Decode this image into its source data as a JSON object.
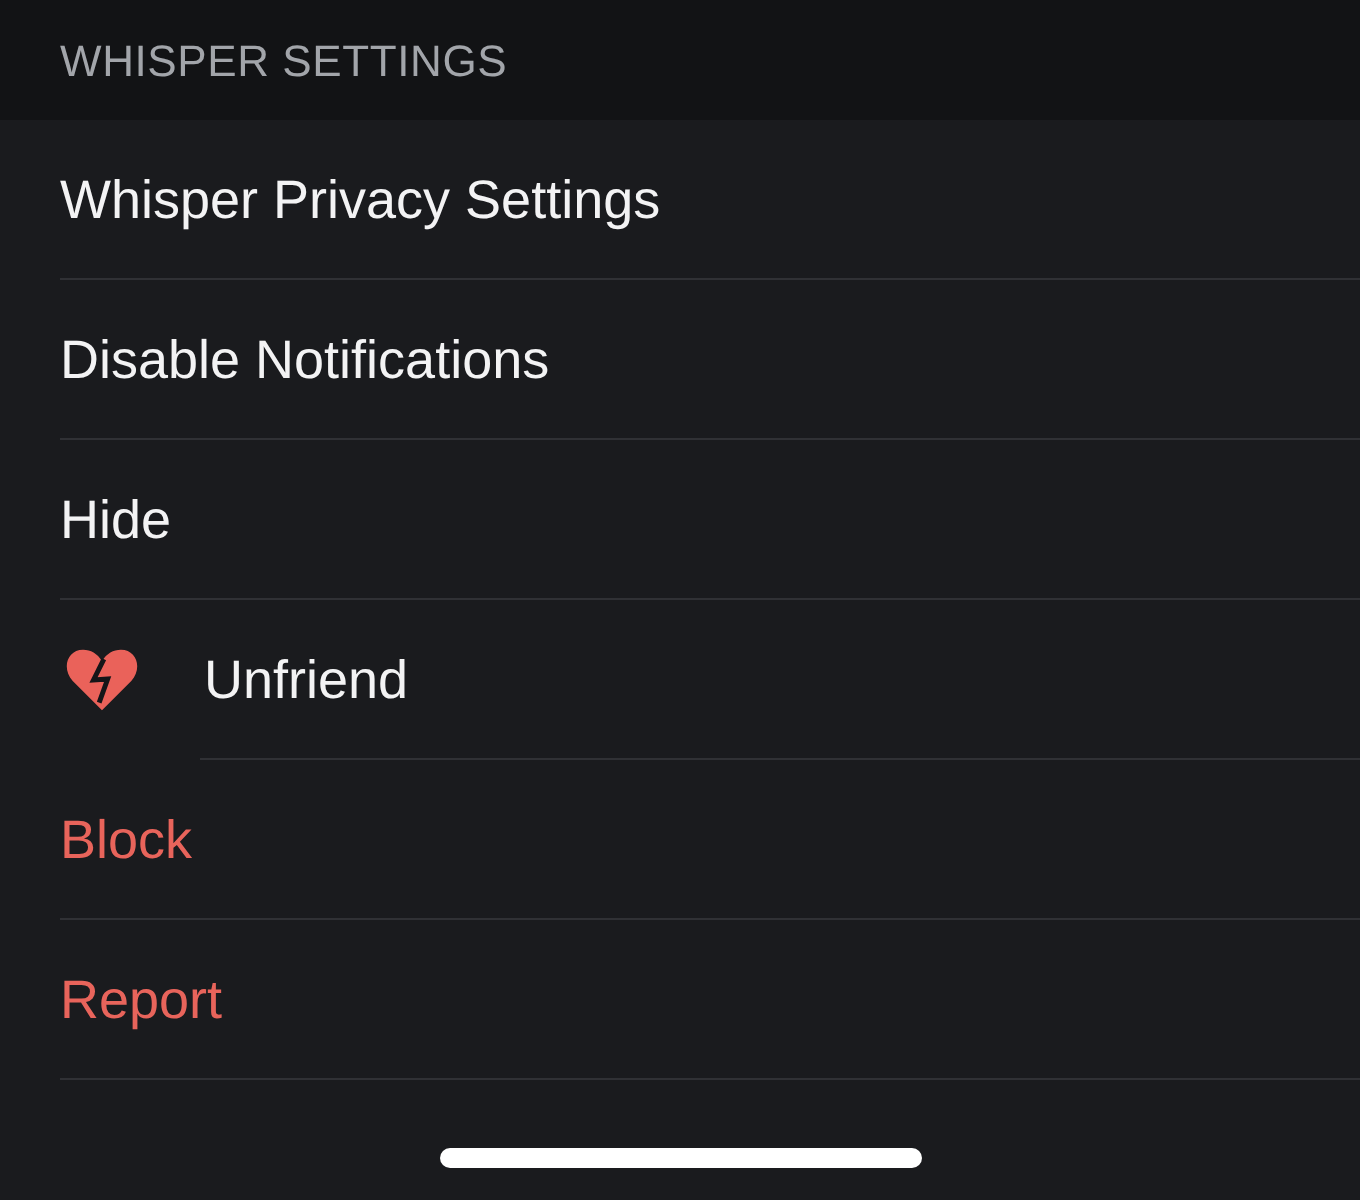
{
  "section": {
    "title": "WHISPER SETTINGS"
  },
  "items": [
    {
      "label": "Whisper Privacy Settings",
      "kind": "plain"
    },
    {
      "label": "Disable Notifications",
      "kind": "plain"
    },
    {
      "label": "Hide",
      "kind": "plain"
    },
    {
      "label": "Unfriend",
      "kind": "icon"
    },
    {
      "label": "Block",
      "kind": "destructive"
    },
    {
      "label": "Report",
      "kind": "destructive"
    }
  ]
}
